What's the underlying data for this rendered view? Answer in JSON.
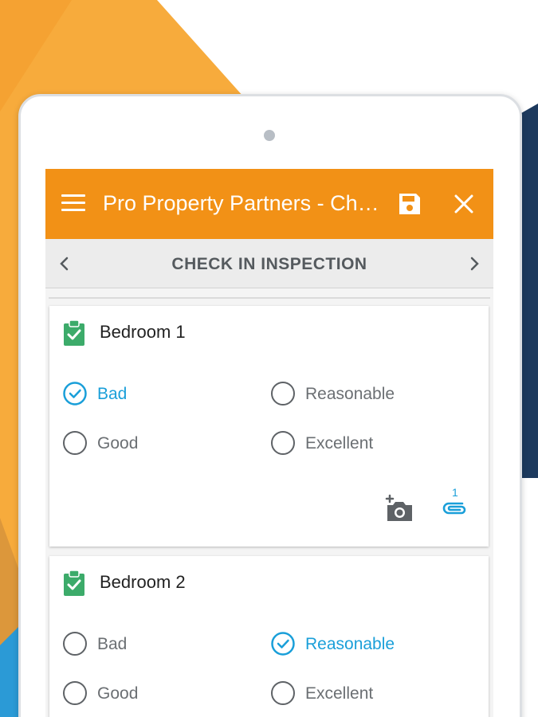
{
  "app": {
    "title": "Pro Property Partners - Check In Inspection"
  },
  "subheader": {
    "title": "CHECK IN INSPECTION"
  },
  "colors": {
    "appbar": "#f29116",
    "accent_blue": "#1a9fd9",
    "check_green": "#3cab6a"
  },
  "icons": {
    "menu": "hamburger-menu-icon",
    "save": "floppy-disk-icon",
    "close": "close-icon",
    "prev": "chevron-left-icon",
    "next": "chevron-right-icon",
    "room_status": "clipboard-check-icon",
    "add_photo": "camera-add-icon",
    "attachments": "paperclip-icon"
  },
  "rooms": [
    {
      "name": "Bedroom 1",
      "options": [
        "Bad",
        "Reasonable",
        "Good",
        "Excellent"
      ],
      "selected": "Bad",
      "attachment_count": "1"
    },
    {
      "name": "Bedroom 2",
      "options": [
        "Bad",
        "Reasonable",
        "Good",
        "Excellent"
      ],
      "selected": "Reasonable"
    }
  ]
}
